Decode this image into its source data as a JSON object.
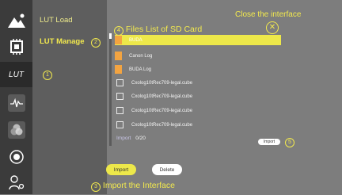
{
  "rail": {
    "items": [
      {
        "name": "landscape-icon"
      },
      {
        "name": "chip-icon"
      },
      {
        "label": "LUT"
      },
      {
        "name": "waveform-icon"
      },
      {
        "name": "color-circles-icon"
      },
      {
        "name": "record-icon"
      },
      {
        "name": "person-settings-icon"
      }
    ]
  },
  "menu": {
    "items": [
      {
        "label": "LUT Load"
      },
      {
        "label": "LUT Manage"
      }
    ],
    "annotations": {
      "lut_manage_num": "2",
      "lut_num": "1"
    }
  },
  "panel": {
    "close_text": "Close the interface",
    "close_symbol": "✕",
    "list_title_num": "4",
    "list_title": "Files List of SD Card",
    "files": [
      {
        "name": "BUDA",
        "type": "folder",
        "selected": true
      },
      {
        "name": "Canon Log",
        "type": "folder",
        "selected": false
      },
      {
        "name": "BUDA Log",
        "type": "folder",
        "selected": false
      },
      {
        "name": "Cxolog10tRec709-legal.cube",
        "type": "file",
        "selected": false
      },
      {
        "name": "Cxolog10tRec709-legal.cube",
        "type": "file",
        "selected": false
      },
      {
        "name": "Cxolog10tRec709-legal.cube",
        "type": "file",
        "selected": false
      },
      {
        "name": "Cxolog10tRec709-legal.cube",
        "type": "file",
        "selected": false
      }
    ],
    "import_label": "Import",
    "import_count": "0/20",
    "small_import_label": "Import",
    "annot5": "5",
    "buttons": {
      "import": "Import",
      "delete": "Delete"
    },
    "bottom_annot_num": "3",
    "bottom_annot": "Import the Interface"
  },
  "colors": {
    "accent": "#ede84a",
    "folder": "#f3a441",
    "rail": "#3b3b3b",
    "menu": "#5e5e5e",
    "panel": "#7d7d7d"
  }
}
